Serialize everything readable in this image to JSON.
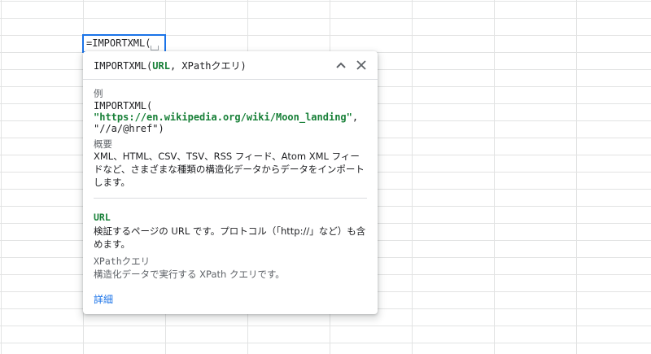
{
  "cell": {
    "formula": "=IMPORTXML("
  },
  "card": {
    "signature": {
      "fn_open": "IMPORTXML(",
      "arg1": "URL",
      "separator": ", ",
      "arg2": "XPathクエリ",
      "close": ")"
    },
    "example": {
      "label": "例",
      "line1": "IMPORTXML(",
      "line2_str": "\"https://en.wikipedia.org/wiki/Moon_landing\"",
      "line2_rest": ",",
      "line3": "\"//a/@href\")"
    },
    "summary": {
      "label": "概要",
      "text": "XML、HTML、CSV、TSV、RSS フィード、Atom XML フィードなど、さまざまな種類の構造化データからデータをインポートします。"
    },
    "args": [
      {
        "name": "URL",
        "desc": "検証するページの URL です。プロトコル（「http://」など）も含めます。",
        "active": true
      },
      {
        "name": "XPathクエリ",
        "desc": "構造化データで実行する XPath クエリです。",
        "active": false
      }
    ],
    "more_link": "詳細"
  },
  "colors": {
    "accent": "#1a73e8",
    "arg_active": "#188038",
    "muted": "#5f6368"
  },
  "icons": {
    "collapse": "chevron-up-icon",
    "close": "close-icon"
  }
}
